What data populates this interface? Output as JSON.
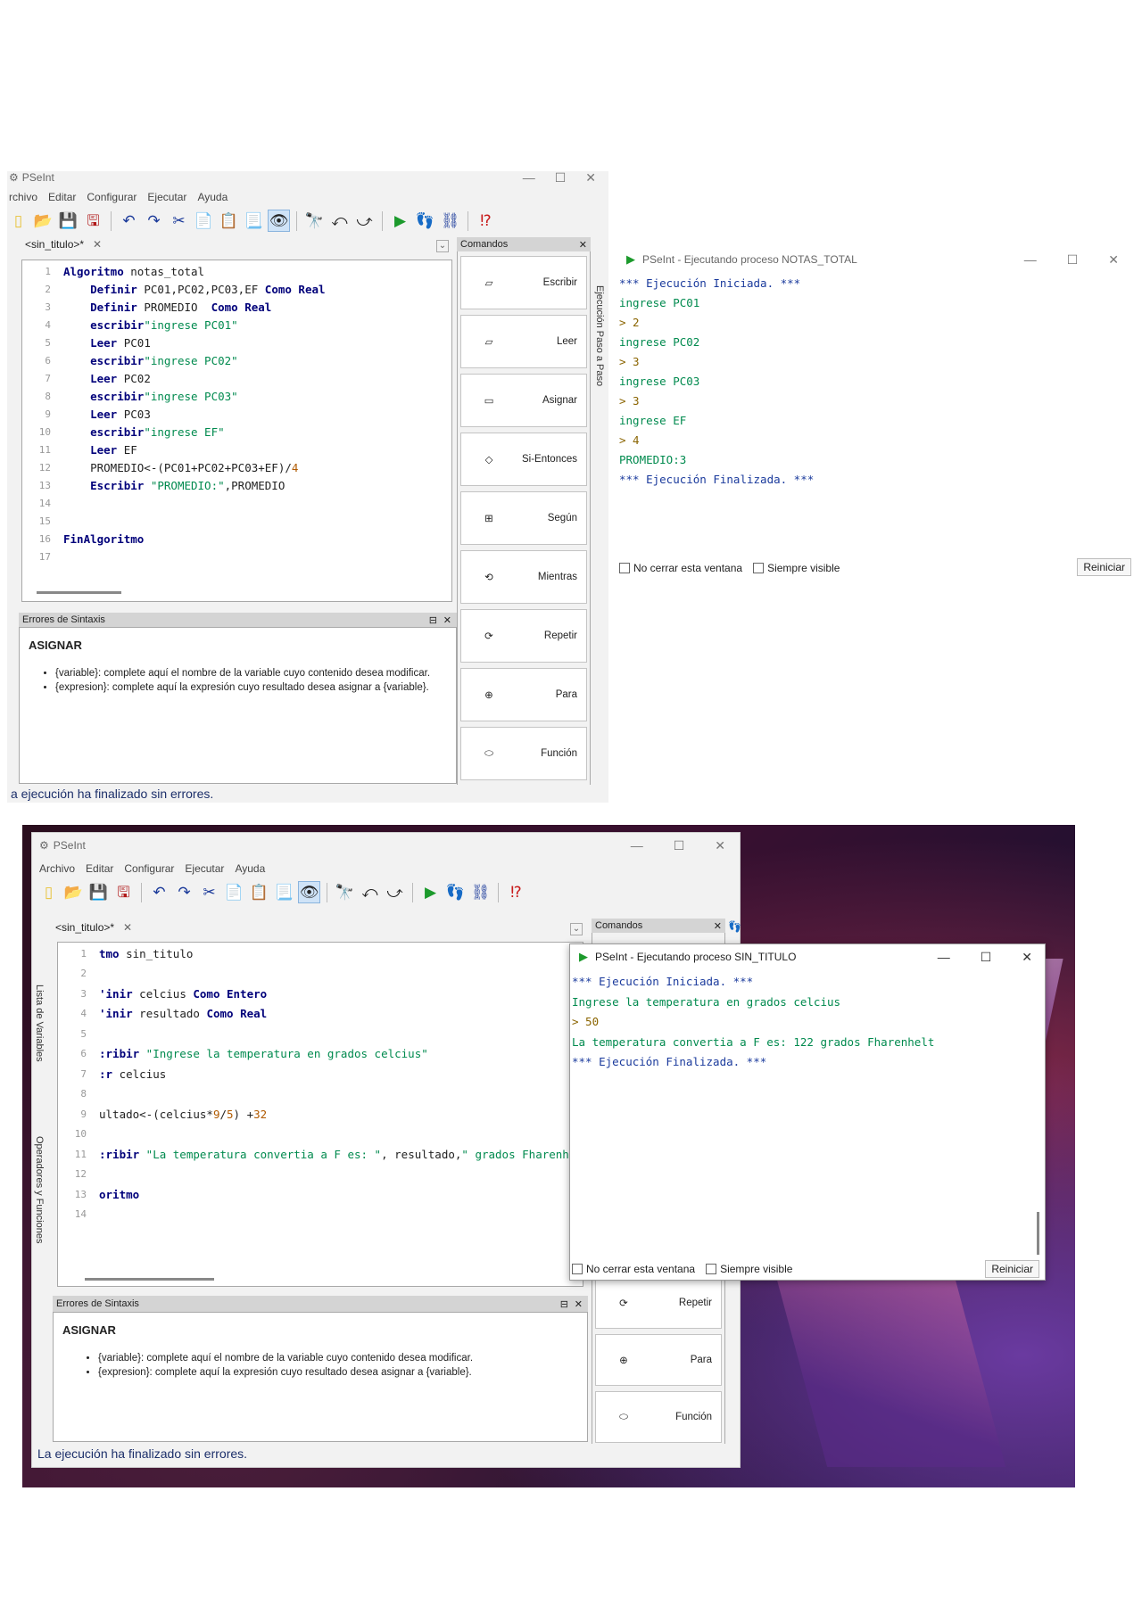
{
  "top_window": {
    "title": "PSeInt",
    "menu": [
      "rchivo",
      "Editar",
      "Configurar",
      "Ejecutar",
      "Ayuda"
    ],
    "tab_label": "<sin_titulo>*",
    "code_lines": [
      {
        "n": "1",
        "parts": [
          {
            "t": "Algoritmo",
            "c": "kw"
          },
          {
            "t": " notas_total",
            "c": "code"
          }
        ]
      },
      {
        "n": "2",
        "parts": [
          {
            "t": "    Definir",
            "c": "kw"
          },
          {
            "t": " PC01,PC02,PC03,EF ",
            "c": "code"
          },
          {
            "t": "Como Real",
            "c": "kw"
          }
        ]
      },
      {
        "n": "3",
        "parts": [
          {
            "t": "    Definir",
            "c": "kw"
          },
          {
            "t": " PROMEDIO  ",
            "c": "code"
          },
          {
            "t": "Como Real",
            "c": "kw"
          }
        ]
      },
      {
        "n": "4",
        "parts": [
          {
            "t": "    escribir",
            "c": "kw"
          },
          {
            "t": "\"ingrese PC01\"",
            "c": "str"
          }
        ]
      },
      {
        "n": "5",
        "parts": [
          {
            "t": "    Leer",
            "c": "kw"
          },
          {
            "t": " PC01",
            "c": "code"
          }
        ]
      },
      {
        "n": "6",
        "parts": [
          {
            "t": "    escribir",
            "c": "kw"
          },
          {
            "t": "\"ingrese PC02\"",
            "c": "str"
          }
        ]
      },
      {
        "n": "7",
        "parts": [
          {
            "t": "    Leer",
            "c": "kw"
          },
          {
            "t": " PC02",
            "c": "code"
          }
        ]
      },
      {
        "n": "8",
        "parts": [
          {
            "t": "    escribir",
            "c": "kw"
          },
          {
            "t": "\"ingrese PC03\"",
            "c": "str"
          }
        ]
      },
      {
        "n": "9",
        "parts": [
          {
            "t": "    Leer",
            "c": "kw"
          },
          {
            "t": " PC03",
            "c": "code"
          }
        ]
      },
      {
        "n": "10",
        "parts": [
          {
            "t": "    escribir",
            "c": "kw"
          },
          {
            "t": "\"ingrese EF\"",
            "c": "str"
          }
        ]
      },
      {
        "n": "11",
        "parts": [
          {
            "t": "    Leer",
            "c": "kw"
          },
          {
            "t": " EF",
            "c": "code"
          }
        ]
      },
      {
        "n": "12",
        "parts": [
          {
            "t": "    PROMEDIO<-(PC01+PC02+PC03+EF)/",
            "c": "code"
          },
          {
            "t": "4",
            "c": "num"
          }
        ]
      },
      {
        "n": "13",
        "parts": [
          {
            "t": "    Escribir",
            "c": "kw"
          },
          {
            "t": " \"PROMEDIO:\"",
            "c": "str"
          },
          {
            "t": ",PROMEDIO",
            "c": "code"
          }
        ]
      },
      {
        "n": "14",
        "parts": []
      },
      {
        "n": "15",
        "parts": []
      },
      {
        "n": "16",
        "parts": [
          {
            "t": "FinAlgoritmo",
            "c": "kw"
          }
        ]
      },
      {
        "n": "17",
        "parts": []
      }
    ],
    "commands_title": "Comandos",
    "commands": [
      "Escribir",
      "Leer",
      "Asignar",
      "Si-Entonces",
      "Según",
      "Mientras",
      "Repetir",
      "Para",
      "Función"
    ],
    "side_tab": "Ejecución Paso a Paso",
    "errors_title": "Errores de Sintaxis",
    "error_heading": "ASIGNAR",
    "error_items": [
      "{variable}: complete aquí el nombre de la variable cuyo contenido desea modificar.",
      "{expresion}: complete aquí la expresión cuyo resultado desea asignar a {variable}."
    ],
    "status": "a ejecución ha finalizado sin errores."
  },
  "top_console": {
    "title": "PSeInt - Ejecutando proceso NOTAS_TOTAL",
    "lines": [
      {
        "t": "*** Ejecución Iniciada. ***",
        "c": "blue"
      },
      {
        "t": "ingrese PC01",
        "c": "green"
      },
      {
        "t": "> 2",
        "c": "olive"
      },
      {
        "t": "ingrese PC02",
        "c": "green"
      },
      {
        "t": "> 3",
        "c": "olive"
      },
      {
        "t": "ingrese PC03",
        "c": "green"
      },
      {
        "t": "> 3",
        "c": "olive"
      },
      {
        "t": "ingrese EF",
        "c": "green"
      },
      {
        "t": "> 4",
        "c": "olive"
      },
      {
        "t": "PROMEDIO:3",
        "c": "green"
      },
      {
        "t": "*** Ejecución Finalizada. ***",
        "c": "blue"
      }
    ],
    "no_cerrar": "No cerrar esta ventana",
    "siempre_visible": "Siempre visible",
    "reiniciar": "Reiniciar"
  },
  "bottom_window": {
    "title": "PSeInt",
    "menu": [
      "Archivo",
      "Editar",
      "Configurar",
      "Ejecutar",
      "Ayuda"
    ],
    "tab_label": "<sin_titulo>*",
    "side_tab_1": "Lista de Variables",
    "side_tab_2": "Operadores y Funciones",
    "code_lines": [
      {
        "n": "1",
        "parts": [
          {
            "t": "tmo ",
            "c": "kw"
          },
          {
            "t": "sin_titulo",
            "c": "code"
          }
        ]
      },
      {
        "n": "2",
        "parts": []
      },
      {
        "n": "3",
        "parts": [
          {
            "t": "'inir",
            "c": "kw"
          },
          {
            "t": " celcius ",
            "c": "code"
          },
          {
            "t": "Como Entero",
            "c": "kw"
          }
        ]
      },
      {
        "n": "4",
        "parts": [
          {
            "t": "'inir",
            "c": "kw"
          },
          {
            "t": " resultado ",
            "c": "code"
          },
          {
            "t": "Como Real",
            "c": "kw"
          }
        ]
      },
      {
        "n": "5",
        "parts": []
      },
      {
        "n": "6",
        "parts": [
          {
            "t": ":ribir",
            "c": "kw"
          },
          {
            "t": " \"Ingrese la temperatura en grados celcius\"",
            "c": "str"
          }
        ]
      },
      {
        "n": "7",
        "parts": [
          {
            "t": ":r",
            "c": "kw"
          },
          {
            "t": " celcius",
            "c": "code"
          }
        ]
      },
      {
        "n": "8",
        "parts": []
      },
      {
        "n": "9",
        "parts": [
          {
            "t": "ultado<-(celcius*",
            "c": "code"
          },
          {
            "t": "9",
            "c": "num"
          },
          {
            "t": "/",
            "c": "code"
          },
          {
            "t": "5",
            "c": "num"
          },
          {
            "t": ") +",
            "c": "code"
          },
          {
            "t": "32",
            "c": "num"
          }
        ]
      },
      {
        "n": "10",
        "parts": []
      },
      {
        "n": "11",
        "parts": [
          {
            "t": ":ribir",
            "c": "kw"
          },
          {
            "t": " \"La temperatura convertia a F es: \"",
            "c": "str"
          },
          {
            "t": ", resultado,",
            "c": "code"
          },
          {
            "t": "\" grados Fharenhelt\"",
            "c": "str"
          }
        ]
      },
      {
        "n": "12",
        "parts": []
      },
      {
        "n": "13",
        "parts": [
          {
            "t": "oritmo",
            "c": "kw"
          }
        ]
      },
      {
        "n": "14",
        "parts": []
      }
    ],
    "commands_title": "Comandos",
    "commands": [
      "Repetir",
      "Para",
      "Función"
    ],
    "errors_title": "Errores de Sintaxis",
    "error_heading": "ASIGNAR",
    "error_items": [
      "{variable}: complete aquí el nombre de la variable cuyo contenido desea modificar.",
      "{expresion}: complete aquí la expresión cuyo resultado desea asignar a {variable}."
    ],
    "status": "La ejecución ha finalizado sin errores."
  },
  "bottom_console": {
    "title": "PSeInt - Ejecutando proceso SIN_TITULO",
    "lines": [
      {
        "t": "*** Ejecución Iniciada. ***",
        "c": "blue"
      },
      {
        "t": "Ingrese la temperatura en grados celcius",
        "c": "green"
      },
      {
        "t": "> 50",
        "c": "olive"
      },
      {
        "t": "La temperatura convertia a F es: 122 grados Fharenhelt",
        "c": "green"
      },
      {
        "t": "*** Ejecución Finalizada. ***",
        "c": "blue"
      }
    ],
    "no_cerrar": "No cerrar esta ventana",
    "siempre_visible": "Siempre visible",
    "reiniciar": "Reiniciar"
  },
  "colors": {
    "keyword": "#00007a",
    "string": "#008a4e",
    "number": "#b05a00",
    "status": "#1c2f6a"
  }
}
